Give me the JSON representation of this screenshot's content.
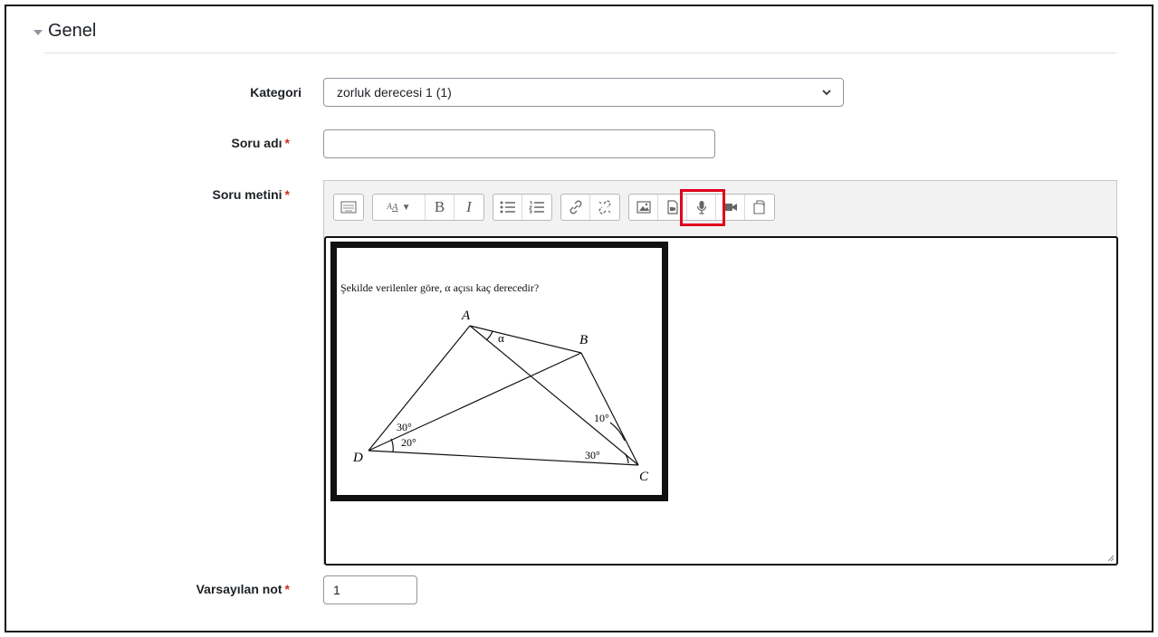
{
  "section": {
    "title": "Genel"
  },
  "fields": {
    "category": {
      "label": "Kategori",
      "value": "zorluk derecesi 1 (1)"
    },
    "question_name": {
      "label": "Soru adı",
      "value": ""
    },
    "question_text": {
      "label": "Soru metini"
    },
    "default_mark": {
      "label": "Varsayılan not",
      "value": "1"
    },
    "required_marker": "*"
  },
  "toolbar": {
    "font_size_glyph": "A",
    "bold": "B",
    "italic": "I"
  },
  "figure": {
    "prompt": "Şekilde verilenler göre, α açısı kaç derecedir?",
    "points": {
      "A": "A",
      "B": "B",
      "C": "C",
      "D": "D"
    },
    "angles": {
      "alpha": "α",
      "d_upper": "30°",
      "d_lower": "20°",
      "c_upper": "10°",
      "c_lower": "30°"
    }
  },
  "colors": {
    "highlight": "#e1001a",
    "required": "#ca3120",
    "border": "#8f959e"
  }
}
